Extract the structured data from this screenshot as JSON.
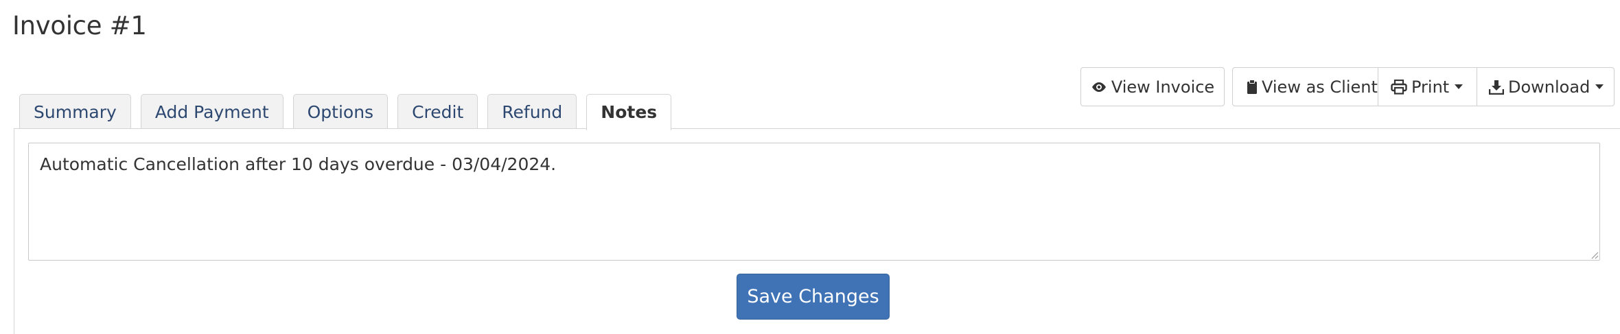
{
  "page": {
    "title": "Invoice #1"
  },
  "tabs": [
    {
      "label": "Summary",
      "active": false
    },
    {
      "label": "Add Payment",
      "active": false
    },
    {
      "label": "Options",
      "active": false
    },
    {
      "label": "Credit",
      "active": false
    },
    {
      "label": "Refund",
      "active": false
    },
    {
      "label": "Notes",
      "active": true
    }
  ],
  "toolbar": {
    "view_invoice": {
      "label": "View Invoice",
      "icon": "eye-icon"
    },
    "view_as_client": {
      "label": "View as Client",
      "icon": "clipboard-icon"
    },
    "print": {
      "label": "Print",
      "icon": "printer-icon"
    },
    "download": {
      "label": "Download",
      "icon": "download-icon"
    }
  },
  "notes": {
    "value": "Automatic Cancellation after 10 days overdue - 03/04/2024.",
    "save_label": "Save Changes"
  },
  "colors": {
    "primary_button": "#3f73b5",
    "tab_link": "#2d4870",
    "border": "#d4d4d4"
  }
}
